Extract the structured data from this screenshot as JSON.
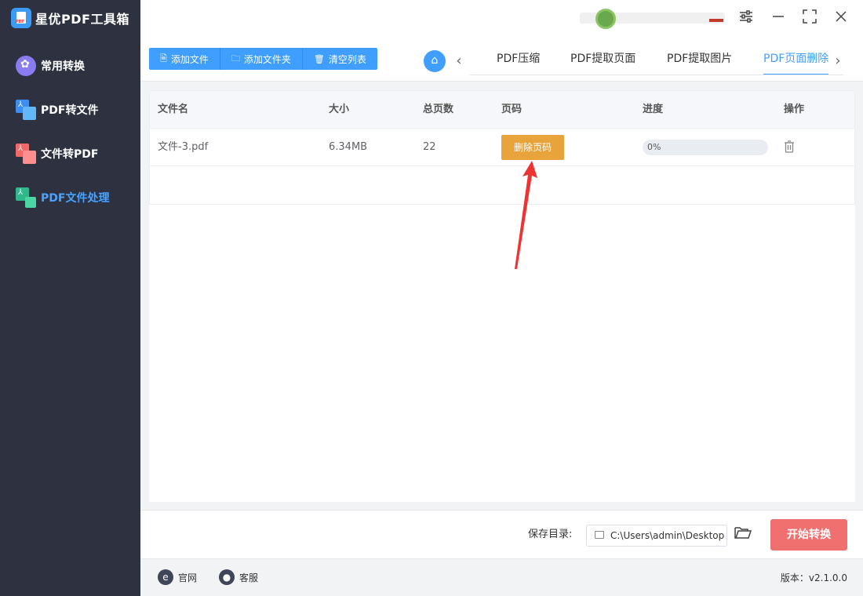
{
  "app": {
    "title": "星优PDF工具箱"
  },
  "sidebar": {
    "items": [
      {
        "label": "常用转换",
        "icon": "grid-flower-icon"
      },
      {
        "label": "PDF转文件",
        "icon": "pdf-to-file-icon"
      },
      {
        "label": "文件转PDF",
        "icon": "file-to-pdf-icon"
      },
      {
        "label": "PDF文件处理",
        "icon": "pdf-process-icon",
        "active": true
      }
    ]
  },
  "toolbar": {
    "add_file": "添加文件",
    "add_folder": "添加文件夹",
    "clear_list": "清空列表"
  },
  "tabs": [
    {
      "label": "PDF压缩"
    },
    {
      "label": "PDF提取页面"
    },
    {
      "label": "PDF提取图片"
    },
    {
      "label": "PDF页面删除",
      "active": true
    }
  ],
  "table": {
    "headers": [
      "文件名",
      "大小",
      "总页数",
      "页码",
      "进度",
      "操作"
    ],
    "rows": [
      {
        "name": "文件-3.pdf",
        "size": "6.34MB",
        "pages": "22",
        "page_action": "删除页码",
        "progress_text": "0%",
        "progress": 0
      }
    ]
  },
  "bottom": {
    "save_label": "保存目录:",
    "save_path": "C:\\Users\\admin\\Desktop",
    "start_button": "开始转换"
  },
  "footer": {
    "website": "官网",
    "support": "客服",
    "version": "版本：v2.1.0.0"
  },
  "colors": {
    "accent": "#409eff",
    "sidebar_bg": "#2d3140",
    "delete_button": "#e8a33b",
    "start_button": "#f07070",
    "annotation_arrow": "#ee3333"
  }
}
